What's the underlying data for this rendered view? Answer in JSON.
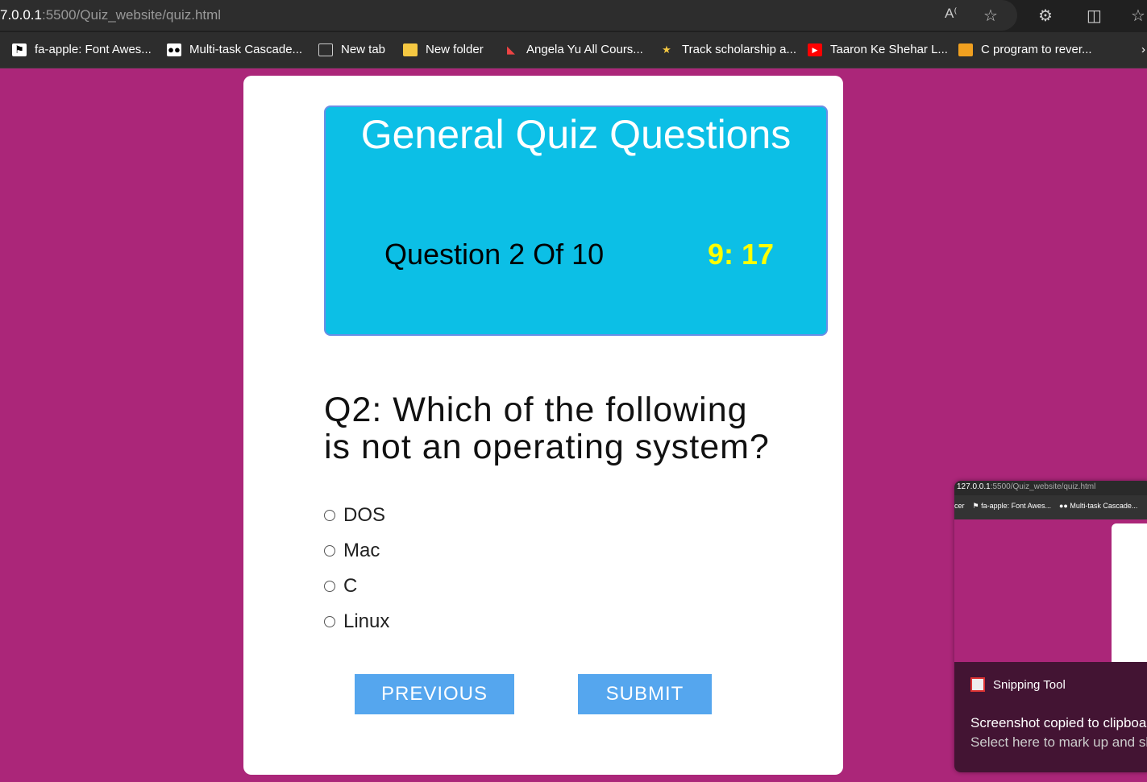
{
  "browser": {
    "url_host": "7.0.0.1",
    "url_path": ":5500/Quiz_website/quiz.html",
    "icons": [
      "read-aloud-icon",
      "favorite-star-icon",
      "extensions-icon",
      "split-screen-icon",
      "favorites-icon"
    ],
    "bookmarks": [
      {
        "label": "fa-apple: Font Awes...",
        "icon": "flag-icon"
      },
      {
        "label": "Multi-task Cascade...",
        "icon": "medium-icon"
      },
      {
        "label": "New tab",
        "icon": "new-tab-icon"
      },
      {
        "label": "New folder",
        "icon": "folder-icon"
      },
      {
        "label": "Angela Yu All Cours...",
        "icon": "udemy-icon"
      },
      {
        "label": "Track scholarship a...",
        "icon": "scholarship-icon"
      },
      {
        "label": "Taaron Ke Shehar L...",
        "icon": "youtube-icon"
      },
      {
        "label": "C program to rever...",
        "icon": "java-cup-icon"
      }
    ]
  },
  "quiz": {
    "title": "General Quiz Questions",
    "count": "Question 2 Of 10",
    "timer": "9: 17",
    "question": "Q2: Which of the following is not an operating system?",
    "options": [
      "DOS",
      "Mac",
      "C",
      "Linux"
    ],
    "previous_label": "PREVIOUS",
    "submit_label": "SUBMIT"
  },
  "colors": {
    "background": "#ab2679",
    "header": "#0cbfe6",
    "timer": "#ffff00",
    "button": "#55a6ee"
  },
  "notification": {
    "preview_url_host": "127.0.0.1",
    "preview_url_path": ":5500/Quiz_website/quiz.html",
    "preview_bookmarks": [
      "cer",
      "fa-apple: Font Awes...",
      "Multi-task Cascade..."
    ],
    "app": "Snipping Tool",
    "line1": "Screenshot copied to clipboard",
    "line2": "Select here to mark up and share"
  }
}
